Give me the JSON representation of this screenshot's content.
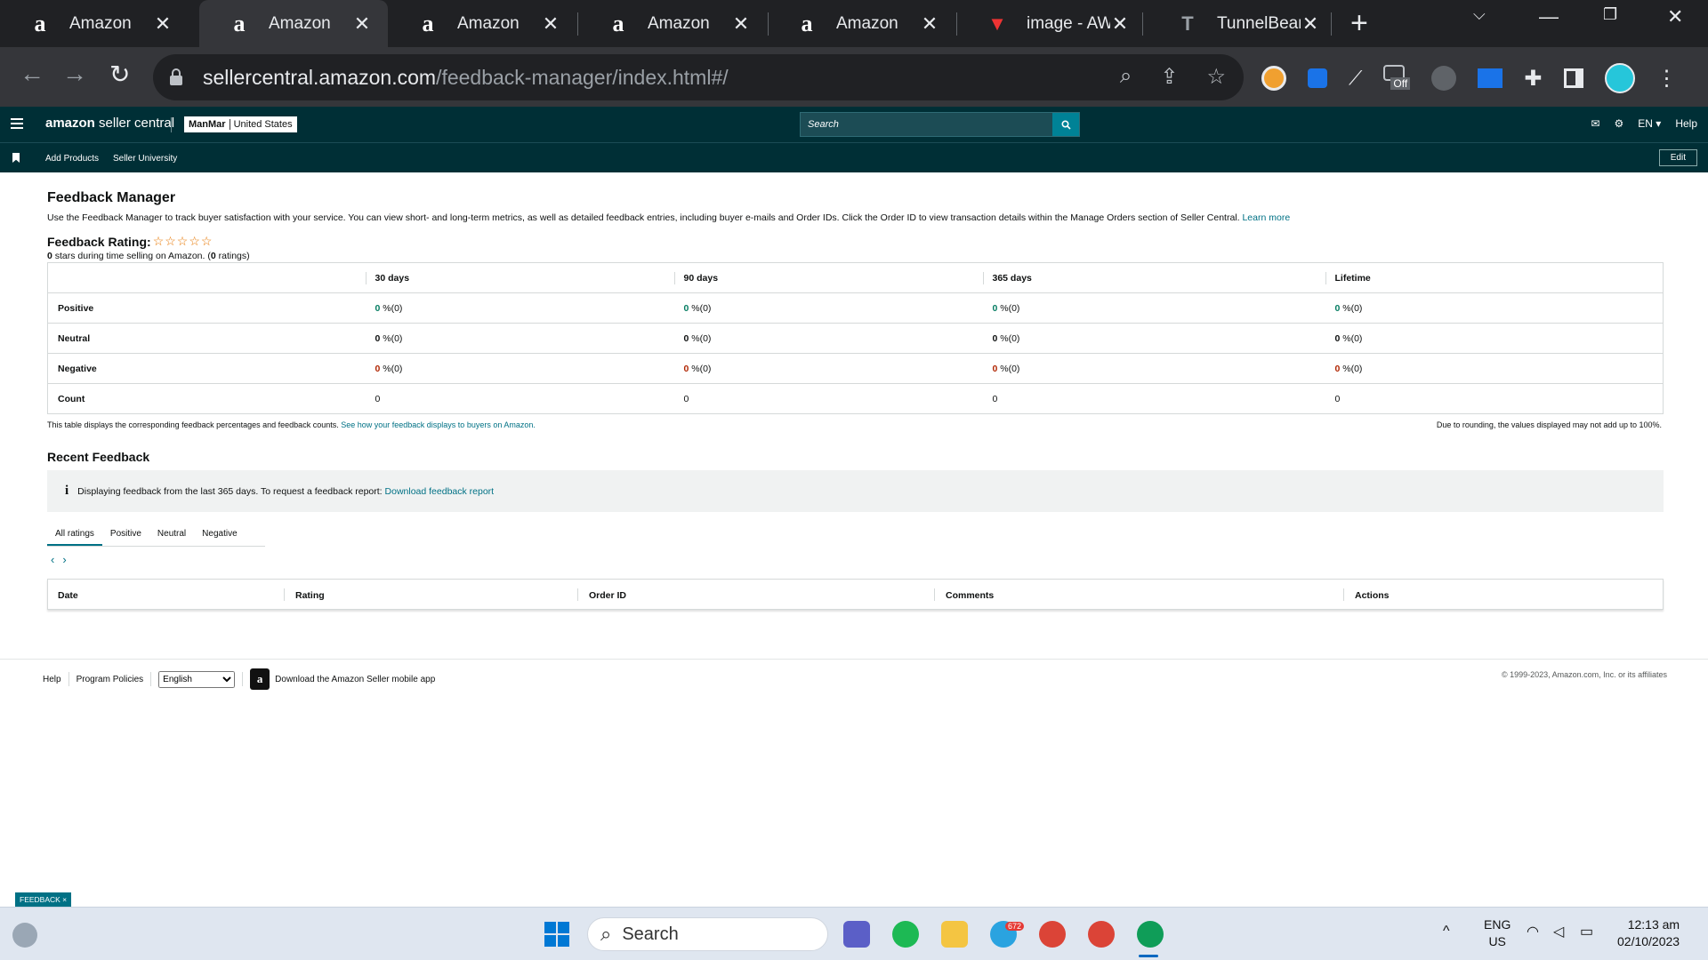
{
  "browser": {
    "tabs": [
      {
        "title": "Amazon",
        "favicon": "amazon-icon",
        "active": false
      },
      {
        "title": "Amazon",
        "favicon": "amazon-icon",
        "active": true
      },
      {
        "title": "Amazon",
        "favicon": "amazon-icon",
        "active": false
      },
      {
        "title": "Amazon",
        "favicon": "amazon-icon",
        "active": false
      },
      {
        "title": "Amazon",
        "favicon": "amazon-icon",
        "active": false
      },
      {
        "title": "image - AWL",
        "favicon": "awl-icon",
        "active": false
      },
      {
        "title": "TunnelBear: S",
        "favicon": "tunnelbear-icon",
        "active": false
      }
    ],
    "url_host": "sellercentral.amazon.com",
    "url_path": "/feedback-manager/index.html#/",
    "ext_badge": "Off"
  },
  "header": {
    "logo_amazon": "amazon",
    "logo_rest": " seller central",
    "store_name": "ManMar",
    "store_region": "United States",
    "search_placeholder": "Search",
    "lang": "EN ▾",
    "help": "Help"
  },
  "subnav": {
    "items": [
      "Add Products",
      "Seller University"
    ],
    "edit": "Edit"
  },
  "page": {
    "title": "Feedback Manager",
    "description": "Use the Feedback Manager to track buyer satisfaction with your service. You can view short- and long-term metrics, as well as detailed feedback entries, including buyer e-mails and Order IDs. Click the Order ID to view transaction details within the Manage Orders section of Seller Central.",
    "learn_more": "Learn more",
    "rating_label": "Feedback Rating:",
    "stars": "☆☆☆☆☆",
    "rating_sub_count": "0",
    "rating_sub_mid": " stars during time selling on Amazon. (",
    "rating_sub_ratings": "0",
    "rating_sub_end": " ratings)"
  },
  "metrics": {
    "columns": [
      "30 days",
      "90 days",
      "365 days",
      "Lifetime"
    ],
    "rows": [
      {
        "label": "Positive",
        "value": "0",
        "suffix": " %(0)"
      },
      {
        "label": "Neutral",
        "value": "0",
        "suffix": " %(0)"
      },
      {
        "label": "Negative",
        "value": "0",
        "suffix": " %(0)"
      }
    ],
    "count_label": "Count",
    "count_value": "0",
    "note": "This table displays the corresponding feedback percentages and feedback counts.",
    "note_link": "See how your feedback displays to buyers on Amazon.",
    "rounding_note": "Due to rounding, the values displayed may not add up to 100%."
  },
  "recent": {
    "title": "Recent Feedback",
    "info_text": "Displaying feedback from the last 365 days. To request a feedback report:",
    "info_link": "Download feedback report",
    "tabs": [
      "All ratings",
      "Positive",
      "Neutral",
      "Negative"
    ],
    "columns": [
      "Date",
      "Rating",
      "Order ID",
      "Comments",
      "Actions"
    ]
  },
  "footer": {
    "help": "Help",
    "policies": "Program Policies",
    "language": "English",
    "app": "Download the Amazon Seller mobile app",
    "copyright": "© 1999-2023, Amazon.com, Inc. or its affiliates",
    "feedback_tag": "FEEDBACK ×"
  },
  "taskbar": {
    "search": "Search",
    "telegram_badge": "672",
    "lang_top": "ENG",
    "lang_bottom": "US",
    "time": "12:13 am",
    "date": "02/10/2023"
  },
  "colors": {
    "sc_header": "#002f36",
    "link": "#007185",
    "positive": "#067d62",
    "negative": "#b12704"
  }
}
